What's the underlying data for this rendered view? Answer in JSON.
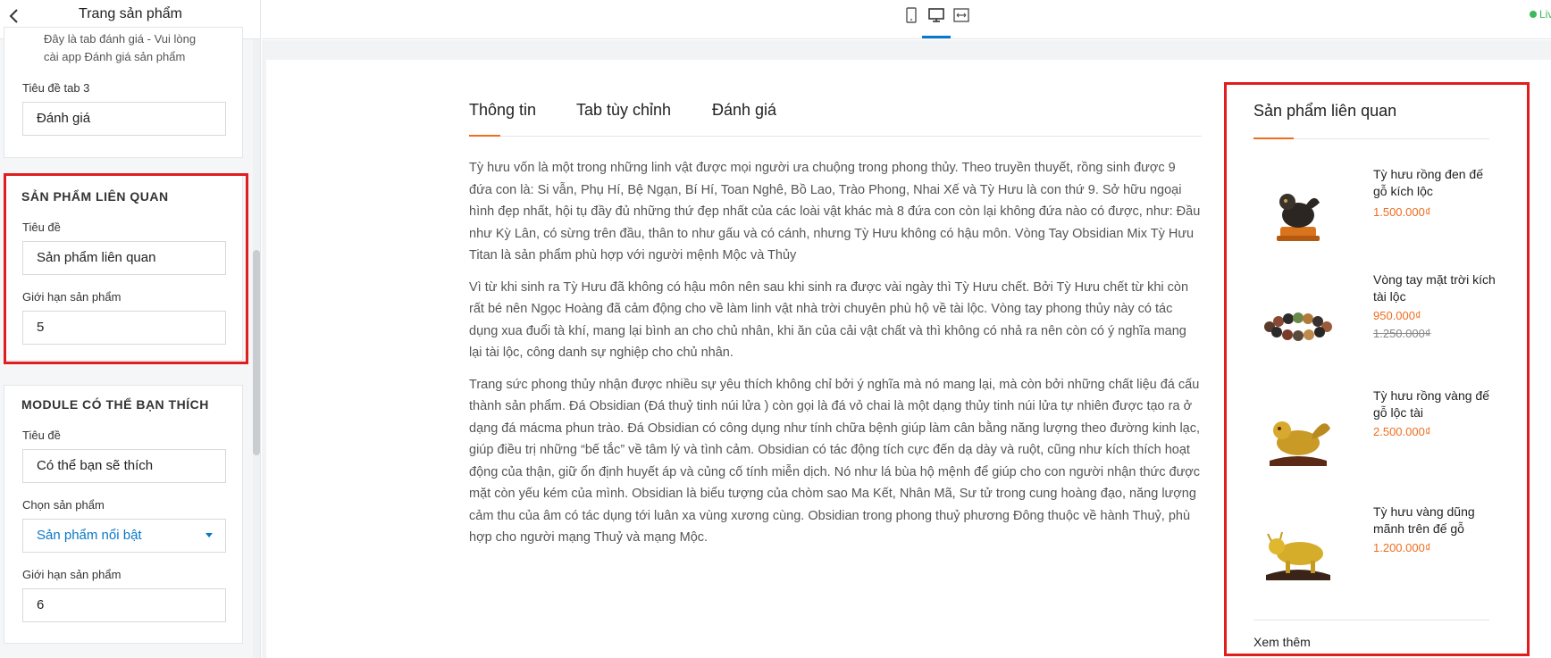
{
  "sidebar": {
    "title": "Trang sản phẩm",
    "helper_text_line1": "Đây là tab đánh giá - Vui lòng",
    "helper_text_line2": "cài app Đánh giá sản phẩm",
    "tab3_label": "Tiêu đề tab 3",
    "tab3_value": "Đánh giá",
    "related": {
      "heading": "SẢN PHẨM LIÊN QUAN",
      "title_label": "Tiêu đề",
      "title_value": "Sản phẩm liên quan",
      "limit_label": "Giới hạn sản phẩm",
      "limit_value": "5"
    },
    "module": {
      "heading": "MODULE CÓ THỂ BẠN THÍCH",
      "title_label": "Tiêu đề",
      "title_value": "Có thể bạn sẽ thích",
      "select_label": "Chọn sản phẩm",
      "select_value": "Sản phẩm nổi bật",
      "limit_label": "Giới hạn sản phẩm",
      "limit_value": "6"
    }
  },
  "topbar": {
    "live_label": "Live",
    "devices": [
      "mobile-icon",
      "desktop-icon",
      "fullwidth-icon"
    ]
  },
  "tabs": [
    "Thông tin",
    "Tab tùy chỉnh",
    "Đánh giá"
  ],
  "article": [
    [
      "Tỳ hưu vốn là một trong những linh vật được mọi người ưa chuộng trong phong thủy. Theo truyền thuyết, rồng sinh được 9",
      "đứa con là: Si vẫn, Phụ Hí, Bệ Ngạn, Bí Hí, Toan Nghê, Bồ Lao, Trào Phong, Nhai Xế và Tỳ Hưu là con thứ 9. Sở hữu ngoại",
      "hình đẹp nhất, hội tụ đầy đủ những thứ đẹp nhất của các loài vật khác mà 8 đứa con còn lại không đứa nào có được, như: Đầu",
      "như Kỳ Lân, có sừng trên đầu, thân to như gấu và có cánh, nhưng Tỳ Hưu không có hậu môn. Vòng Tay Obsidian Mix Tỳ Hưu",
      "Titan là sản phẩm phù hợp với người mệnh Mộc và Thủy"
    ],
    [
      "Vì từ khi sinh ra Tỳ Hưu đã không có hậu môn nên sau khi sinh ra được vài ngày thì Tỳ Hưu chết. Bởi Tỳ Hưu chết từ khi còn",
      "rất bé nên Ngọc Hoàng đã cảm động cho về làm linh vật nhà trời chuyên phù hộ về tài lộc. Vòng tay phong thủy này có tác",
      "dụng xua đuổi tà khí, mang lại bình an cho chủ nhân, khi ăn của cải vật chất và thì không có nhả ra nên còn có ý nghĩa mang",
      "lại tài lộc, công danh sự nghiệp cho chủ nhân."
    ],
    [
      "Trang sức phong thủy nhận được nhiều sự yêu thích không chỉ bởi ý nghĩa mà nó mang lại, mà còn bởi những chất liệu đá cấu",
      "thành sản phẩm. Đá Obsidian (Đá thuỷ tinh núi lửa ) còn gọi là đá vỏ chai là một dạng thủy tinh núi lửa tự nhiên được tạo ra ở",
      "dạng đá mácma phun trào. Đá Obsidian có công dụng như tính chữa bệnh giúp làm cân bằng năng lượng theo đường kinh lạc,",
      "giúp điều trị những “bế tắc” về tâm lý và tình cảm. Obsidian có tác động tích cực đến dạ dày và ruột, cũng như kích thích hoạt",
      "động của thận, giữ ổn định huyết áp và củng cố tính miễn dịch. Nó như lá bùa hộ mệnh để giúp cho con người nhận thức được",
      "mặt còn yếu kém của mình. Obsidian là biểu tượng của chòm sao Ma Kết, Nhân Mã, Sư tử trong cung hoàng đạo, năng lượng",
      "cảm thu của âm có tác dụng tới luân xa vùng xương cùng. Obsidian trong phong thuỷ phương Đông thuộc về hành Thuỷ, phù",
      "hợp cho người mạng Thuỷ và mạng Mộc."
    ]
  ],
  "related_panel": {
    "title": "Sản phẩm liên quan",
    "more": "Xem thêm",
    "products": [
      {
        "name": "Tỳ hưu rồng đen đế gỗ kích lộc",
        "price": "1.500.000₫",
        "old_price": ""
      },
      {
        "name": "Vòng tay mặt trời kích tài lộc",
        "price": "950.000₫",
        "old_price": "1.250.000₫"
      },
      {
        "name": "Tỳ hưu rồng vàng đế gỗ lộc tài",
        "price": "2.500.000₫",
        "old_price": ""
      },
      {
        "name": "Tỳ hưu vàng dũng mãnh trên đế gỗ",
        "price": "1.200.000₫",
        "old_price": ""
      }
    ]
  }
}
